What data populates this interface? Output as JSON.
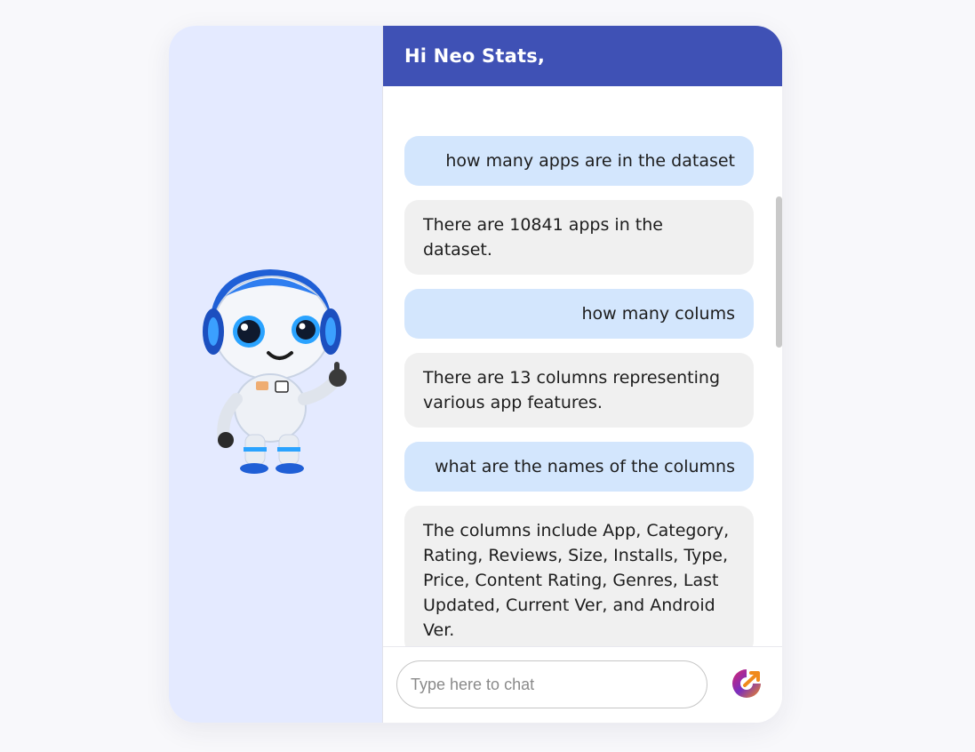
{
  "header": {
    "title": "Hi Neo Stats,"
  },
  "messages": [
    {
      "role": "user",
      "text": "how many apps are in the dataset"
    },
    {
      "role": "bot",
      "text": "There are 10841 apps in the dataset."
    },
    {
      "role": "user",
      "text": "how many colums"
    },
    {
      "role": "bot",
      "text": "There are 13 columns representing various app features."
    },
    {
      "role": "user",
      "text": "what are the names of the columns"
    },
    {
      "role": "bot",
      "text": "The columns include App, Category, Rating, Reviews, Size, Installs, Type, Price, Content Rating, Genres, Last Updated, Current Ver, and Android Ver."
    }
  ],
  "input": {
    "placeholder": "Type here to chat",
    "value": ""
  },
  "icons": {
    "mascot": "robot-mascot",
    "send": "send-icon"
  },
  "colors": {
    "header": "#3f51b5",
    "left_panel": "#e4eaff",
    "user_bubble": "#d3e6fd",
    "bot_bubble": "#f0f0f0"
  }
}
